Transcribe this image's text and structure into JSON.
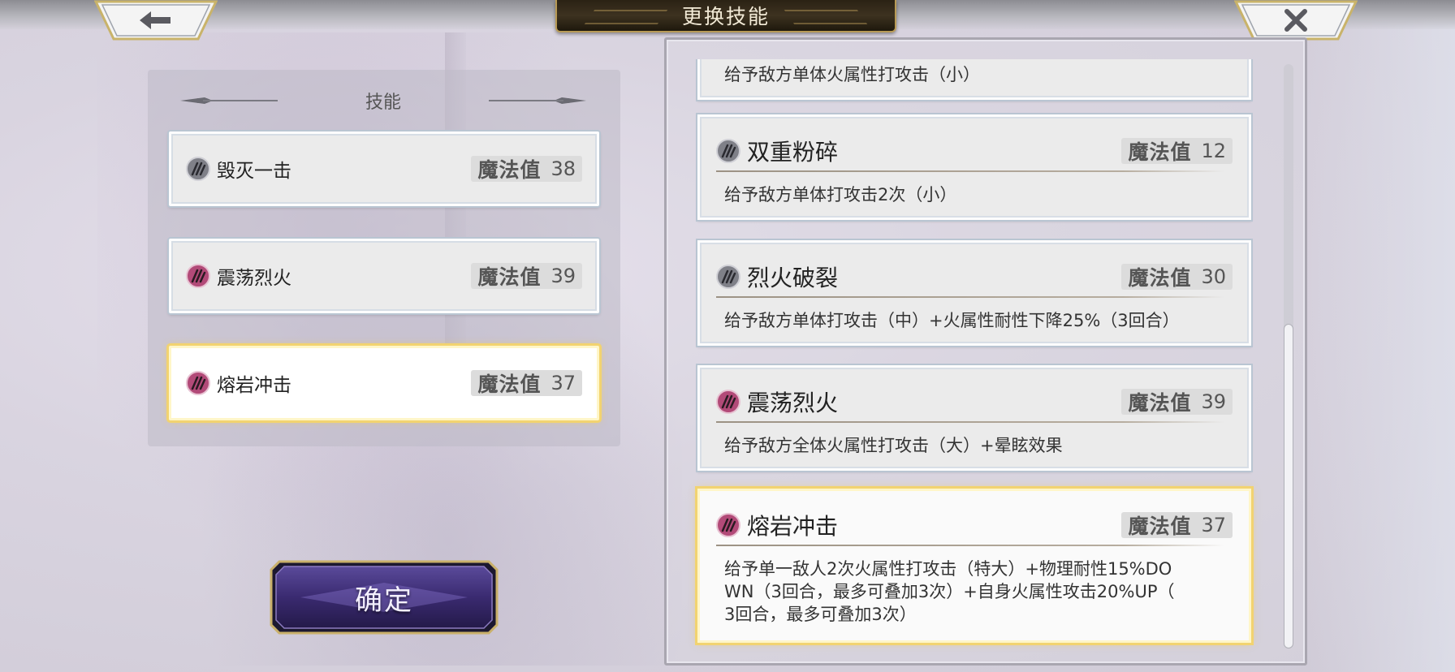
{
  "header": {
    "title": "更换技能"
  },
  "left_panel": {
    "section_title": "技能",
    "mp_label": "魔法值",
    "equipped": [
      {
        "name": "毁灭一击",
        "mp": "38",
        "icon": "gray-orb-icon"
      },
      {
        "name": "震荡烈火",
        "mp": "39",
        "icon": "pink-orb-icon"
      },
      {
        "name": "熔岩冲击",
        "mp": "37",
        "icon": "pink-orb-icon",
        "selected": true
      }
    ],
    "confirm_label": "确定"
  },
  "skill_list": {
    "mp_label": "魔法值",
    "partial_top_desc": "给予敌方单体火属性打攻击（小）",
    "items": [
      {
        "name": "双重粉碎",
        "mp": "12",
        "icon": "gray-orb-icon",
        "desc": "给予敌方单体打攻击2次（小）"
      },
      {
        "name": "烈火破裂",
        "mp": "30",
        "icon": "gray-orb-icon",
        "desc": "给予敌方单体打攻击（中）+火属性耐性下降25%（3回合）"
      },
      {
        "name": "震荡烈火",
        "mp": "39",
        "icon": "pink-orb-icon",
        "desc": "给予敌方全体火属性打攻击（大）+晕眩效果"
      },
      {
        "name": "熔岩冲击",
        "mp": "37",
        "icon": "pink-orb-icon",
        "selected": true,
        "desc_lines": [
          "给予单一敌人2次火属性打攻击（特大）+物理耐性15%DO",
          "WN（3回合，最多可叠加3次）+自身火属性攻击20%UP（",
          "3回合，最多可叠加3次）"
        ]
      }
    ]
  },
  "colors": {
    "selected_border": "#f2d370",
    "title_bg": "#2a2214",
    "confirm_bg": "#3a2a70"
  }
}
